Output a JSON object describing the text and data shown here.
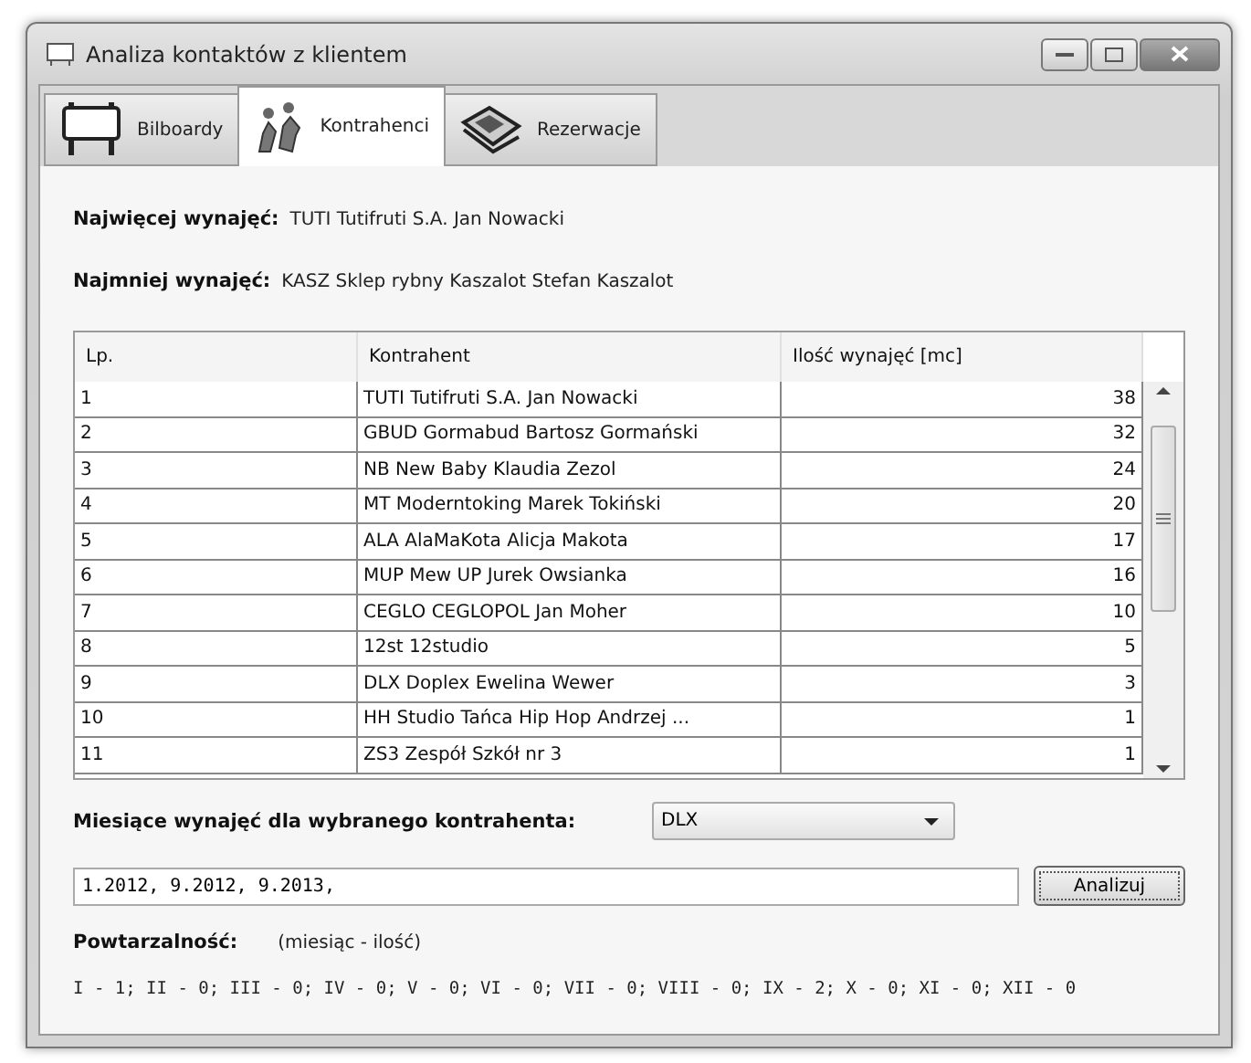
{
  "window": {
    "title": "Analiza kontaktów z klientem"
  },
  "tabs": [
    {
      "label": "Bilboardy",
      "selected": false
    },
    {
      "label": "Kontrahenci",
      "selected": true
    },
    {
      "label": "Rezerwacje",
      "selected": false
    }
  ],
  "summary": [
    {
      "label": "Najwięcej wynajęć:",
      "value": "TUTI Tutifruti S.A. Jan Nowacki"
    },
    {
      "label": "Najmniej wynajęć:",
      "value": "KASZ Sklep rybny Kaszalot Stefan Kaszalot"
    }
  ],
  "table": {
    "columns": [
      "Lp.",
      "Kontrahent",
      "Ilość wynajęć [mc]"
    ],
    "rows": [
      [
        "1",
        "TUTI Tutifruti S.A. Jan Nowacki",
        "38"
      ],
      [
        "2",
        "GBUD Gormabud Bartosz Gormański",
        "32"
      ],
      [
        "3",
        "NB New Baby Klaudia Zezol",
        "24"
      ],
      [
        "4",
        "MT Moderntoking Marek Tokiński",
        "20"
      ],
      [
        "5",
        "ALA AlaMaKota Alicja Makota",
        "17"
      ],
      [
        "6",
        "MUP Mew UP Jurek Owsianka",
        "16"
      ],
      [
        "7",
        "CEGLO CEGLOPOL Jan Moher",
        "10"
      ],
      [
        "8",
        "12st 12studio",
        "5"
      ],
      [
        "9",
        "DLX Doplex Ewelina Wewer",
        "3"
      ],
      [
        "10",
        "HH Studio Tańca Hip Hop Andrzej ...",
        "1"
      ],
      [
        "11",
        "ZS3 Zespół Szkół nr 3",
        "1"
      ]
    ]
  },
  "contractor": {
    "label": "Miesiące wynajęć dla wybranego kontrahenta:",
    "value": "DLX"
  },
  "months_field": {
    "value": "1.2012, 9.2012, 9.2013,"
  },
  "analyze_button": "Analizuj",
  "repeat": {
    "label": "Powtarzalność:",
    "hint": "(miesiąc - ilość)",
    "result": "I - 1; II - 0; III - 0; IV - 0; V - 0; VI - 0; VII - 0; VIII - 0; IX - 2; X - 0; XI - 0; XII - 0"
  }
}
